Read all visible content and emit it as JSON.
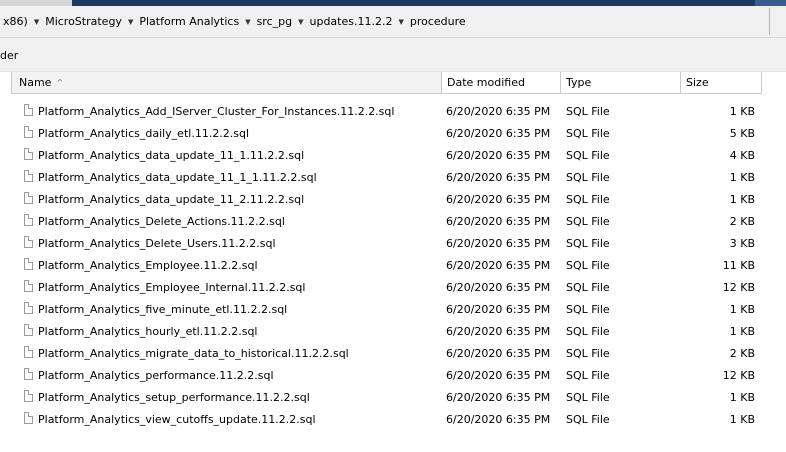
{
  "breadcrumb": {
    "items": [
      "x86)",
      "MicroStrategy",
      "Platform Analytics",
      "src_pg",
      "updates.11.2.2",
      "procedure"
    ]
  },
  "toolbar": {
    "partial_label": "der"
  },
  "columns": {
    "name": "Name",
    "date_modified": "Date modified",
    "type": "Type",
    "size": "Size",
    "sort_indicator": "^"
  },
  "files": [
    {
      "name": "Platform_Analytics_Add_IServer_Cluster_For_Instances.11.2.2.sql",
      "date": "6/20/2020 6:35 PM",
      "type": "SQL File",
      "size": "1 KB"
    },
    {
      "name": "Platform_Analytics_daily_etl.11.2.2.sql",
      "date": "6/20/2020 6:35 PM",
      "type": "SQL File",
      "size": "5 KB"
    },
    {
      "name": "Platform_Analytics_data_update_11_1.11.2.2.sql",
      "date": "6/20/2020 6:35 PM",
      "type": "SQL File",
      "size": "4 KB"
    },
    {
      "name": "Platform_Analytics_data_update_11_1_1.11.2.2.sql",
      "date": "6/20/2020 6:35 PM",
      "type": "SQL File",
      "size": "1 KB"
    },
    {
      "name": "Platform_Analytics_data_update_11_2.11.2.2.sql",
      "date": "6/20/2020 6:35 PM",
      "type": "SQL File",
      "size": "1 KB"
    },
    {
      "name": "Platform_Analytics_Delete_Actions.11.2.2.sql",
      "date": "6/20/2020 6:35 PM",
      "type": "SQL File",
      "size": "2 KB"
    },
    {
      "name": "Platform_Analytics_Delete_Users.11.2.2.sql",
      "date": "6/20/2020 6:35 PM",
      "type": "SQL File",
      "size": "3 KB"
    },
    {
      "name": "Platform_Analytics_Employee.11.2.2.sql",
      "date": "6/20/2020 6:35 PM",
      "type": "SQL File",
      "size": "11 KB"
    },
    {
      "name": "Platform_Analytics_Employee_Internal.11.2.2.sql",
      "date": "6/20/2020 6:35 PM",
      "type": "SQL File",
      "size": "12 KB"
    },
    {
      "name": "Platform_Analytics_five_minute_etl.11.2.2.sql",
      "date": "6/20/2020 6:35 PM",
      "type": "SQL File",
      "size": "1 KB"
    },
    {
      "name": "Platform_Analytics_hourly_etl.11.2.2.sql",
      "date": "6/20/2020 6:35 PM",
      "type": "SQL File",
      "size": "1 KB"
    },
    {
      "name": "Platform_Analytics_migrate_data_to_historical.11.2.2.sql",
      "date": "6/20/2020 6:35 PM",
      "type": "SQL File",
      "size": "2 KB"
    },
    {
      "name": "Platform_Analytics_performance.11.2.2.sql",
      "date": "6/20/2020 6:35 PM",
      "type": "SQL File",
      "size": "12 KB"
    },
    {
      "name": "Platform_Analytics_setup_performance.11.2.2.sql",
      "date": "6/20/2020 6:35 PM",
      "type": "SQL File",
      "size": "1 KB"
    },
    {
      "name": "Platform_Analytics_view_cutoffs_update.11.2.2.sql",
      "date": "6/20/2020 6:35 PM",
      "type": "SQL File",
      "size": "1 KB"
    }
  ]
}
